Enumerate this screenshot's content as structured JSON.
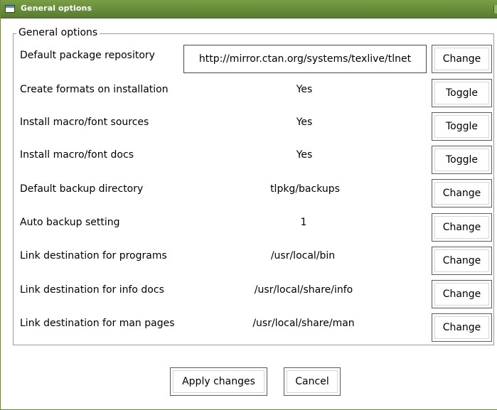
{
  "window": {
    "title": "General options"
  },
  "group": {
    "legend": "General options"
  },
  "rows": [
    {
      "label": "Default package repository",
      "value": "http://mirror.ctan.org/systems/texlive/tlnet",
      "button": "Change"
    },
    {
      "label": "Create formats on installation",
      "value": "Yes",
      "button": "Toggle"
    },
    {
      "label": "Install macro/font sources",
      "value": "Yes",
      "button": "Toggle"
    },
    {
      "label": "Install macro/font docs",
      "value": "Yes",
      "button": "Toggle"
    },
    {
      "label": "Default backup directory",
      "value": "tlpkg/backups",
      "button": "Change"
    },
    {
      "label": "Auto backup setting",
      "value": "1",
      "button": "Change"
    },
    {
      "label": "Link destination for programs",
      "value": "/usr/local/bin",
      "button": "Change"
    },
    {
      "label": "Link destination for info docs",
      "value": "/usr/local/share/info",
      "button": "Change"
    },
    {
      "label": "Link destination for man pages",
      "value": "/usr/local/share/man",
      "button": "Change"
    }
  ],
  "footer": {
    "apply_label": "Apply changes",
    "cancel_label": "Cancel"
  },
  "icons": {
    "window_icon": "window-icon"
  },
  "colors": {
    "titlebar": "#6a8e3c",
    "title_text": "#ffffff",
    "frame": "#9a9a9a"
  }
}
